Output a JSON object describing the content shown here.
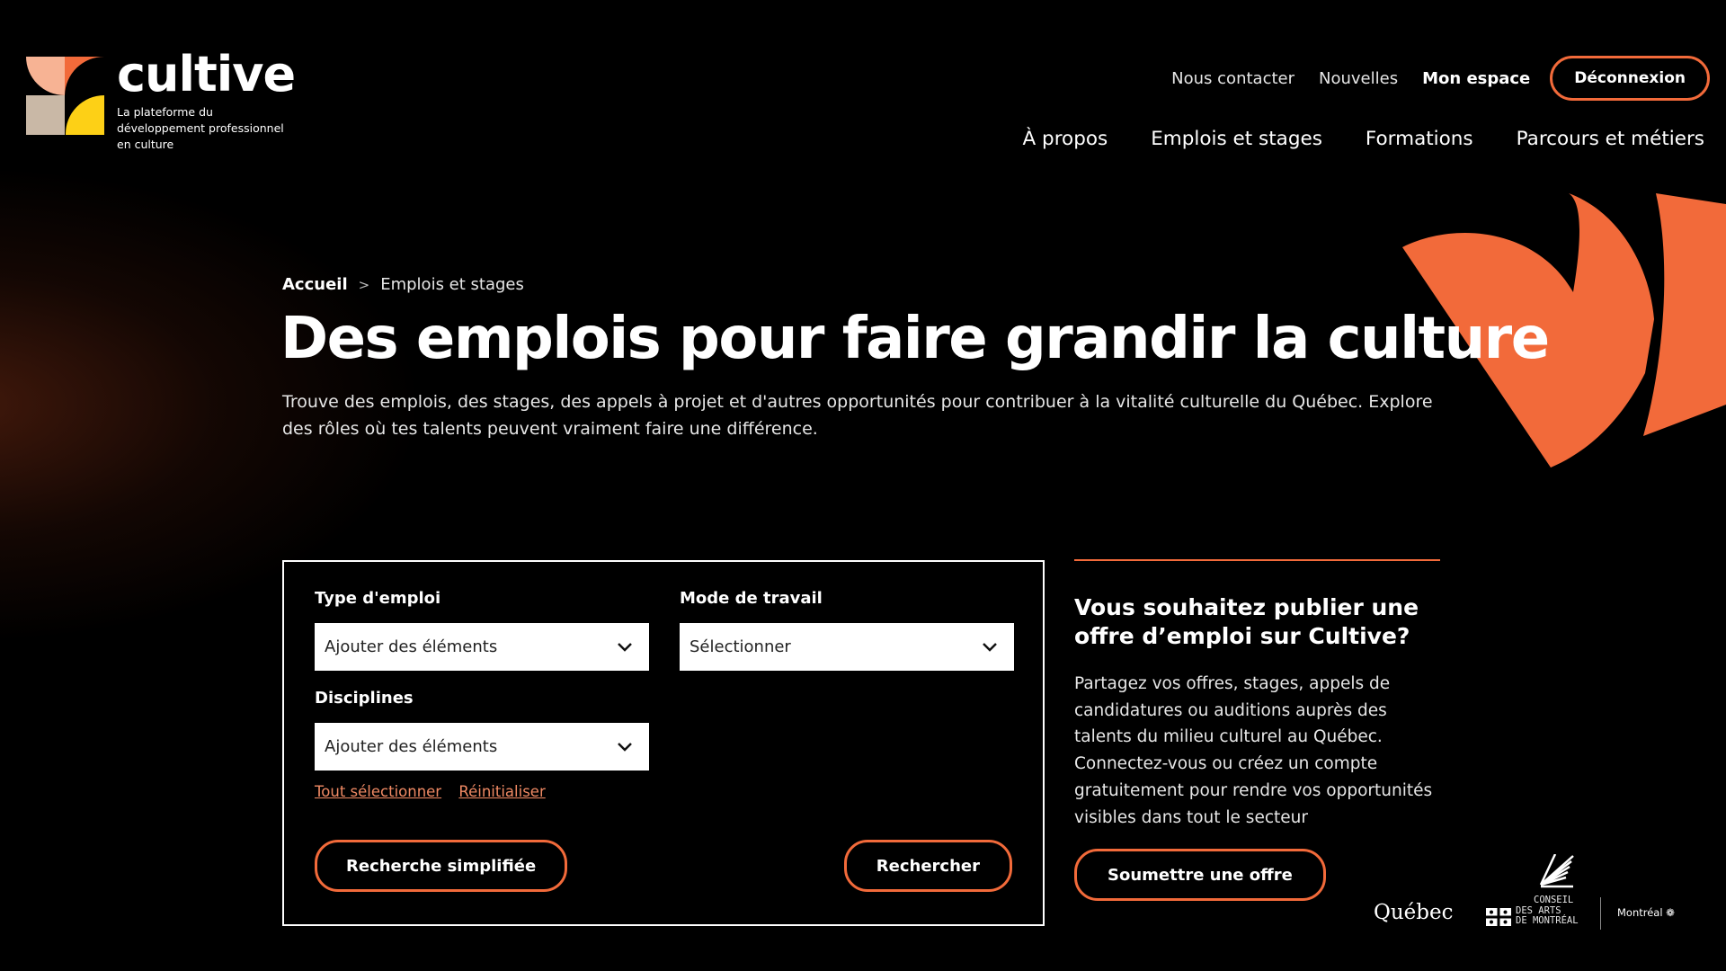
{
  "brand": {
    "name": "cultive",
    "tagline": "La plateforme du développement professionnel en culture",
    "colors": {
      "peach": "#f7b394",
      "orange": "#f26a3a",
      "sand": "#c9b8a6",
      "yellow": "#fdd016"
    }
  },
  "topnav": {
    "contact": "Nous contacter",
    "news": "Nouvelles",
    "space": "Mon espace",
    "logout": "Déconnexion"
  },
  "mainnav": {
    "items": [
      "À propos",
      "Emplois et stages",
      "Formations",
      "Parcours et métiers"
    ]
  },
  "breadcrumb": {
    "home": "Accueil",
    "separator": ">",
    "current": "Emplois et stages"
  },
  "hero": {
    "title": "Des emplois pour faire grandir la culture",
    "intro": "Trouve des emplois, des stages, des appels à projet et d'autres opportunités pour contribuer à la vitalité culturelle du Québec. Explore des rôles où tes talents peuvent vraiment faire une différence."
  },
  "search": {
    "type_label": "Type d'emploi",
    "type_value": "Ajouter des éléments",
    "mode_label": "Mode de travail",
    "mode_value": "Sélectionner",
    "disciplines_label": "Disciplines",
    "disciplines_value": "Ajouter des éléments",
    "select_all": "Tout sélectionner",
    "reset": "Réinitialiser",
    "simple_search": "Recherche simplifiée",
    "search_button": "Rechercher"
  },
  "publish": {
    "title": "Vous souhaitez publier une offre d’emploi sur Cultive?",
    "text": "Partagez vos offres, stages, appels de candidatures ou auditions auprès des talents du milieu culturel au Québec. Connectez-vous ou créez un compte gratuitement pour rendre vos opportunités visibles dans tout le secteur",
    "button": "Soumettre une offre"
  },
  "partners": {
    "quebec": "Québec",
    "cam_line1": "CONSEIL",
    "cam_line2": "DES ARTS",
    "cam_line3": "DE MONTRÉAL",
    "montreal": "Montréal"
  },
  "colors": {
    "accent": "#f26a3a",
    "link": "#f08a64",
    "background": "#000000"
  }
}
